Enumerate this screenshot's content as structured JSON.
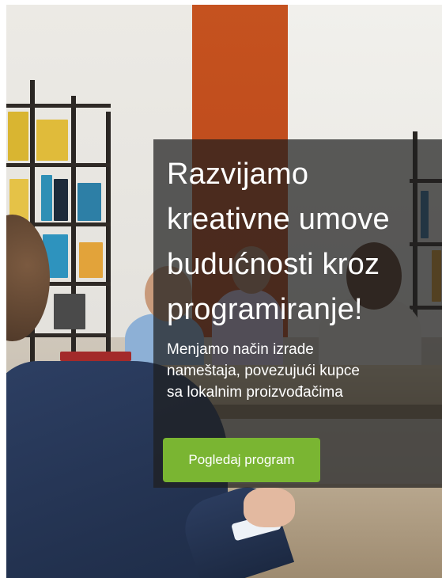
{
  "hero": {
    "headline_lines": [
      "Razvijamo",
      "kreativne umove",
      "budućnosti kroz",
      "programiranje!"
    ],
    "subtext_lines": [
      "Menjamo način izrade",
      "nameštaja, povezujući kupce",
      "sa lokalnim proizvođačima"
    ],
    "cta_label": "Pogledaj program"
  },
  "colors": {
    "overlay": "#1e1e1eb8",
    "cta_background": "#7ab532",
    "text": "#ffffff",
    "accent_pillar": "#c5521f"
  }
}
